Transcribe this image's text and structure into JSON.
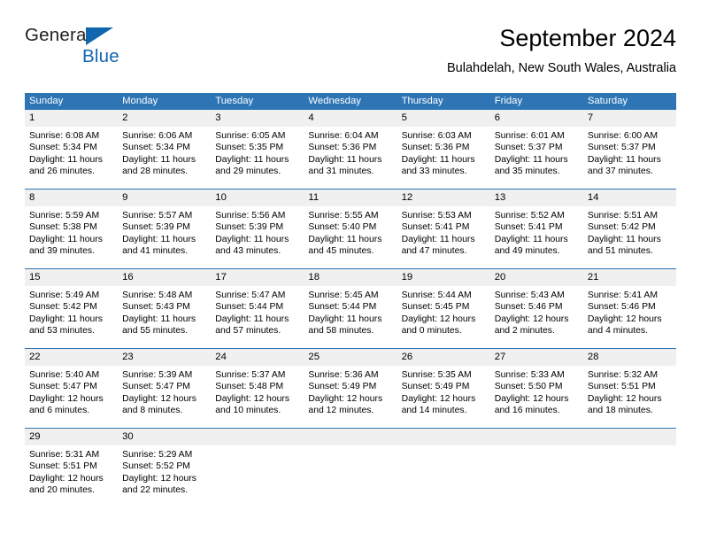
{
  "brand": {
    "name_part1": "General",
    "name_part2": "Blue",
    "triangle_color": "#1266b0"
  },
  "header": {
    "title": "September 2024",
    "subtitle": "Bulahdelah, New South Wales, Australia"
  },
  "colors": {
    "header_blue": "#2e75b6",
    "daynum_band": "#f0f0f0",
    "text": "#000000"
  },
  "weekdays": [
    "Sunday",
    "Monday",
    "Tuesday",
    "Wednesday",
    "Thursday",
    "Friday",
    "Saturday"
  ],
  "weeks": [
    {
      "days": [
        {
          "num": "1",
          "sunrise": "Sunrise: 6:08 AM",
          "sunset": "Sunset: 5:34 PM",
          "daylight1": "Daylight: 11 hours",
          "daylight2": "and 26 minutes."
        },
        {
          "num": "2",
          "sunrise": "Sunrise: 6:06 AM",
          "sunset": "Sunset: 5:34 PM",
          "daylight1": "Daylight: 11 hours",
          "daylight2": "and 28 minutes."
        },
        {
          "num": "3",
          "sunrise": "Sunrise: 6:05 AM",
          "sunset": "Sunset: 5:35 PM",
          "daylight1": "Daylight: 11 hours",
          "daylight2": "and 29 minutes."
        },
        {
          "num": "4",
          "sunrise": "Sunrise: 6:04 AM",
          "sunset": "Sunset: 5:36 PM",
          "daylight1": "Daylight: 11 hours",
          "daylight2": "and 31 minutes."
        },
        {
          "num": "5",
          "sunrise": "Sunrise: 6:03 AM",
          "sunset": "Sunset: 5:36 PM",
          "daylight1": "Daylight: 11 hours",
          "daylight2": "and 33 minutes."
        },
        {
          "num": "6",
          "sunrise": "Sunrise: 6:01 AM",
          "sunset": "Sunset: 5:37 PM",
          "daylight1": "Daylight: 11 hours",
          "daylight2": "and 35 minutes."
        },
        {
          "num": "7",
          "sunrise": "Sunrise: 6:00 AM",
          "sunset": "Sunset: 5:37 PM",
          "daylight1": "Daylight: 11 hours",
          "daylight2": "and 37 minutes."
        }
      ]
    },
    {
      "days": [
        {
          "num": "8",
          "sunrise": "Sunrise: 5:59 AM",
          "sunset": "Sunset: 5:38 PM",
          "daylight1": "Daylight: 11 hours",
          "daylight2": "and 39 minutes."
        },
        {
          "num": "9",
          "sunrise": "Sunrise: 5:57 AM",
          "sunset": "Sunset: 5:39 PM",
          "daylight1": "Daylight: 11 hours",
          "daylight2": "and 41 minutes."
        },
        {
          "num": "10",
          "sunrise": "Sunrise: 5:56 AM",
          "sunset": "Sunset: 5:39 PM",
          "daylight1": "Daylight: 11 hours",
          "daylight2": "and 43 minutes."
        },
        {
          "num": "11",
          "sunrise": "Sunrise: 5:55 AM",
          "sunset": "Sunset: 5:40 PM",
          "daylight1": "Daylight: 11 hours",
          "daylight2": "and 45 minutes."
        },
        {
          "num": "12",
          "sunrise": "Sunrise: 5:53 AM",
          "sunset": "Sunset: 5:41 PM",
          "daylight1": "Daylight: 11 hours",
          "daylight2": "and 47 minutes."
        },
        {
          "num": "13",
          "sunrise": "Sunrise: 5:52 AM",
          "sunset": "Sunset: 5:41 PM",
          "daylight1": "Daylight: 11 hours",
          "daylight2": "and 49 minutes."
        },
        {
          "num": "14",
          "sunrise": "Sunrise: 5:51 AM",
          "sunset": "Sunset: 5:42 PM",
          "daylight1": "Daylight: 11 hours",
          "daylight2": "and 51 minutes."
        }
      ]
    },
    {
      "days": [
        {
          "num": "15",
          "sunrise": "Sunrise: 5:49 AM",
          "sunset": "Sunset: 5:42 PM",
          "daylight1": "Daylight: 11 hours",
          "daylight2": "and 53 minutes."
        },
        {
          "num": "16",
          "sunrise": "Sunrise: 5:48 AM",
          "sunset": "Sunset: 5:43 PM",
          "daylight1": "Daylight: 11 hours",
          "daylight2": "and 55 minutes."
        },
        {
          "num": "17",
          "sunrise": "Sunrise: 5:47 AM",
          "sunset": "Sunset: 5:44 PM",
          "daylight1": "Daylight: 11 hours",
          "daylight2": "and 57 minutes."
        },
        {
          "num": "18",
          "sunrise": "Sunrise: 5:45 AM",
          "sunset": "Sunset: 5:44 PM",
          "daylight1": "Daylight: 11 hours",
          "daylight2": "and 58 minutes."
        },
        {
          "num": "19",
          "sunrise": "Sunrise: 5:44 AM",
          "sunset": "Sunset: 5:45 PM",
          "daylight1": "Daylight: 12 hours",
          "daylight2": "and 0 minutes."
        },
        {
          "num": "20",
          "sunrise": "Sunrise: 5:43 AM",
          "sunset": "Sunset: 5:46 PM",
          "daylight1": "Daylight: 12 hours",
          "daylight2": "and 2 minutes."
        },
        {
          "num": "21",
          "sunrise": "Sunrise: 5:41 AM",
          "sunset": "Sunset: 5:46 PM",
          "daylight1": "Daylight: 12 hours",
          "daylight2": "and 4 minutes."
        }
      ]
    },
    {
      "days": [
        {
          "num": "22",
          "sunrise": "Sunrise: 5:40 AM",
          "sunset": "Sunset: 5:47 PM",
          "daylight1": "Daylight: 12 hours",
          "daylight2": "and 6 minutes."
        },
        {
          "num": "23",
          "sunrise": "Sunrise: 5:39 AM",
          "sunset": "Sunset: 5:47 PM",
          "daylight1": "Daylight: 12 hours",
          "daylight2": "and 8 minutes."
        },
        {
          "num": "24",
          "sunrise": "Sunrise: 5:37 AM",
          "sunset": "Sunset: 5:48 PM",
          "daylight1": "Daylight: 12 hours",
          "daylight2": "and 10 minutes."
        },
        {
          "num": "25",
          "sunrise": "Sunrise: 5:36 AM",
          "sunset": "Sunset: 5:49 PM",
          "daylight1": "Daylight: 12 hours",
          "daylight2": "and 12 minutes."
        },
        {
          "num": "26",
          "sunrise": "Sunrise: 5:35 AM",
          "sunset": "Sunset: 5:49 PM",
          "daylight1": "Daylight: 12 hours",
          "daylight2": "and 14 minutes."
        },
        {
          "num": "27",
          "sunrise": "Sunrise: 5:33 AM",
          "sunset": "Sunset: 5:50 PM",
          "daylight1": "Daylight: 12 hours",
          "daylight2": "and 16 minutes."
        },
        {
          "num": "28",
          "sunrise": "Sunrise: 5:32 AM",
          "sunset": "Sunset: 5:51 PM",
          "daylight1": "Daylight: 12 hours",
          "daylight2": "and 18 minutes."
        }
      ]
    },
    {
      "days": [
        {
          "num": "29",
          "sunrise": "Sunrise: 5:31 AM",
          "sunset": "Sunset: 5:51 PM",
          "daylight1": "Daylight: 12 hours",
          "daylight2": "and 20 minutes."
        },
        {
          "num": "30",
          "sunrise": "Sunrise: 5:29 AM",
          "sunset": "Sunset: 5:52 PM",
          "daylight1": "Daylight: 12 hours",
          "daylight2": "and 22 minutes."
        },
        {
          "num": "",
          "sunrise": "",
          "sunset": "",
          "daylight1": "",
          "daylight2": ""
        },
        {
          "num": "",
          "sunrise": "",
          "sunset": "",
          "daylight1": "",
          "daylight2": ""
        },
        {
          "num": "",
          "sunrise": "",
          "sunset": "",
          "daylight1": "",
          "daylight2": ""
        },
        {
          "num": "",
          "sunrise": "",
          "sunset": "",
          "daylight1": "",
          "daylight2": ""
        },
        {
          "num": "",
          "sunrise": "",
          "sunset": "",
          "daylight1": "",
          "daylight2": ""
        }
      ]
    }
  ]
}
